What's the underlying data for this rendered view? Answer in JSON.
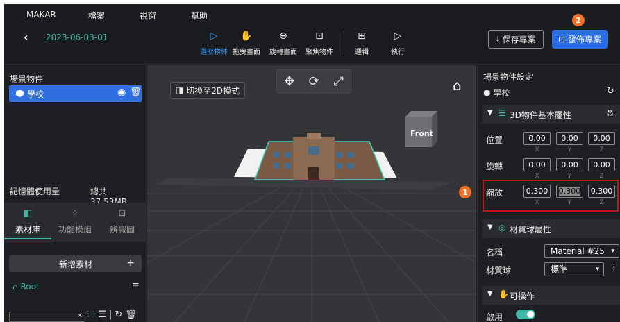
{
  "menu": [
    "MAKAR",
    "檔案",
    "視窗",
    "幫助"
  ],
  "header": {
    "back_icon": "chevron-left-icon",
    "date": "2023-06-03-01"
  },
  "toolbar": {
    "tools": [
      {
        "label": "選取物件",
        "icon": "cursor-icon",
        "active": true
      },
      {
        "label": "拖曳畫面",
        "icon": "hand-icon",
        "active": false
      },
      {
        "label": "旋轉畫面",
        "icon": "rotate-icon",
        "active": false
      },
      {
        "label": "聚焦物件",
        "icon": "focus-icon",
        "active": false
      },
      {
        "label": "邏輯",
        "icon": "logic-icon",
        "active": false
      },
      {
        "label": "執行",
        "icon": "play-icon",
        "active": false
      }
    ],
    "save_label": "保存專案",
    "publish_label": "發佈專案",
    "publish_badge": "2"
  },
  "left_panel": {
    "scene_title": "場景物件",
    "scene_items": [
      {
        "name": "學校"
      }
    ],
    "memory_label": "記憶體使用量",
    "memory_total": "總共 37.53MB",
    "tabs": [
      {
        "label": "素材庫",
        "active": true
      },
      {
        "label": "功能模組",
        "active": false
      },
      {
        "label": "辨識圖",
        "active": false
      }
    ],
    "add_label": "新增素材",
    "add_plus": "+",
    "root_label": "Root",
    "search_value": ""
  },
  "viewport": {
    "switch_2d_label": "切換至2D模式",
    "view_cube_label": "Front"
  },
  "right_panel": {
    "title": "場景物件設定",
    "object_name": "學校",
    "section_3d": "3D物件基本屬性",
    "position_label": "位置",
    "rotation_label": "旋轉",
    "scale_label": "縮放",
    "axis": [
      "X",
      "Y",
      "Z"
    ],
    "position": [
      "0.00",
      "0.00",
      "0.00"
    ],
    "rotation": [
      "0.00",
      "0.00",
      "0.00"
    ],
    "scale": [
      "0.300",
      "0.300",
      "0.300"
    ],
    "scale_badge": "1",
    "section_material": "材質球屬性",
    "name_label": "名稱",
    "material_name": "Material #25",
    "material_label": "材質球",
    "material_value": "標準",
    "section_interact": "可操作",
    "enable_label": "啟用",
    "enabled": true
  },
  "colors": {
    "accent": "#3fb8a8",
    "primary": "#2a6be6",
    "badge": "#f0702a",
    "highlight": "#c0161c"
  }
}
